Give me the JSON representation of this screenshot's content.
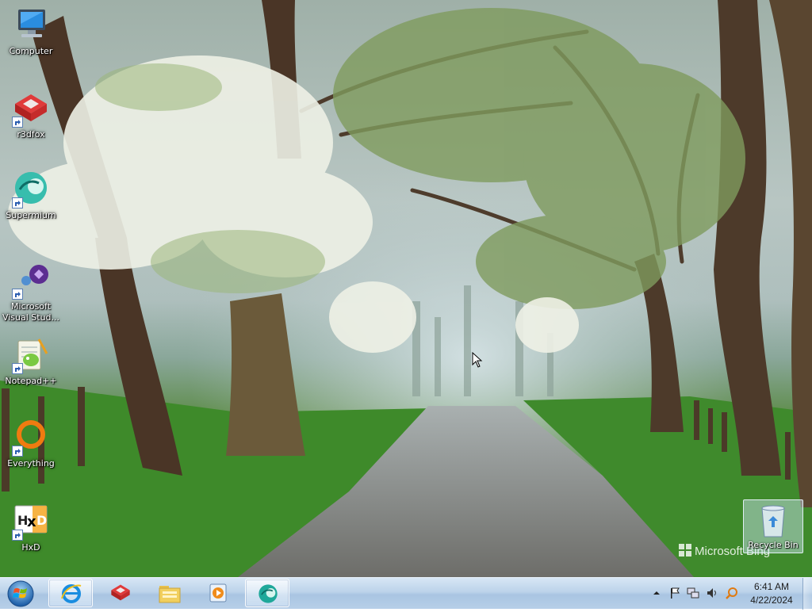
{
  "desktop": {
    "icons": [
      {
        "label": "Computer",
        "icon": "computer-icon"
      },
      {
        "label": "r3dfox",
        "icon": "r3dfox-icon"
      },
      {
        "label": "Supermium",
        "icon": "supermium-icon"
      },
      {
        "label": "Microsoft Visual Stud...",
        "icon": "visual-studio-icon"
      },
      {
        "label": "Notepad++",
        "icon": "notepad-plus-plus-icon"
      },
      {
        "label": "Everything",
        "icon": "everything-icon"
      },
      {
        "label": "HxD",
        "icon": "hxd-icon"
      }
    ],
    "recycle_bin": {
      "label": "Recycle Bin",
      "icon": "recycle-bin-icon"
    },
    "watermark": "Microsoft Bing"
  },
  "taskbar": {
    "start": {
      "icon": "windows-start-orb-icon"
    },
    "pinned": [
      {
        "icon": "internet-explorer-icon",
        "open": true
      },
      {
        "icon": "r3dfox-icon",
        "open": false
      },
      {
        "icon": "file-explorer-icon",
        "open": false
      },
      {
        "icon": "media-player-icon",
        "open": false
      },
      {
        "icon": "supermium-icon",
        "open": true
      }
    ],
    "tray": {
      "icons": [
        "show-hidden-icons-chevron",
        "action-center-flag-icon",
        "network-icon",
        "volume-icon",
        "search-icon"
      ],
      "time": "6:41 AM",
      "date": "4/22/2024"
    }
  },
  "colors": {
    "taskbar_top": "#d7e6f5",
    "taskbar_bottom": "#b7cfe8",
    "label_text": "#ffffff"
  }
}
